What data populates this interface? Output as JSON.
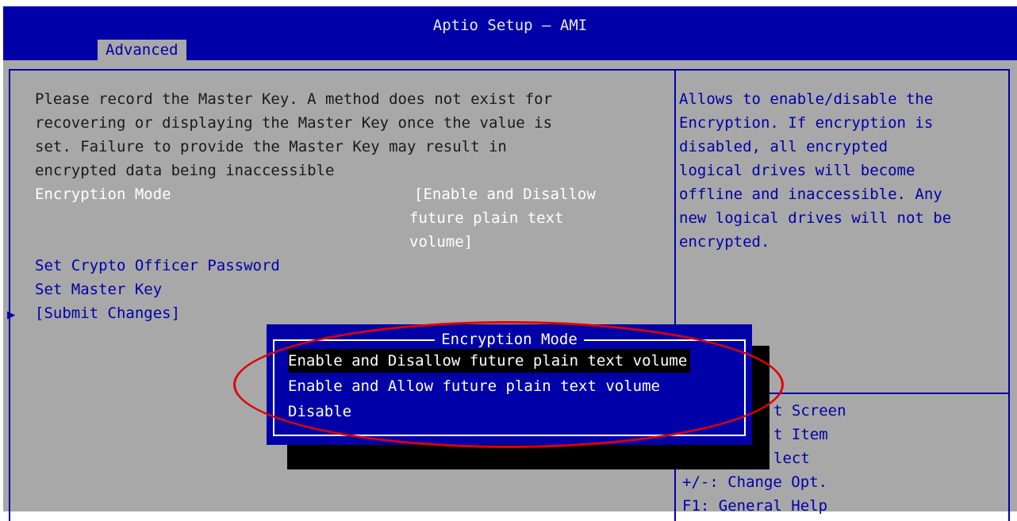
{
  "header": {
    "title": "Aptio Setup – AMI",
    "active_tab": "Advanced"
  },
  "main": {
    "message_lines": [
      "Please record the Master Key. A method does not exist for",
      "recovering or displaying the Master Key once the value is",
      "set. Failure to provide the Master Key may result in",
      "encrypted data being inaccessible"
    ],
    "encryption_mode_label": "Encryption Mode",
    "encryption_mode_value_lines": [
      "[Enable and Disallow",
      "future plain text",
      "volume]"
    ],
    "items": [
      "Set Crypto Officer Password",
      "Set Master Key",
      "[Submit Changes]"
    ]
  },
  "help": {
    "lines": [
      "Allows to enable/disable the",
      "Encryption. If encryption is",
      "disabled, all encrypted",
      "logical drives will become",
      "offline and inaccessible. Any",
      "new logical drives will not be",
      "encrypted."
    ]
  },
  "keys": {
    "lines": [
      "t Screen",
      "t Item",
      "lect",
      "+/-: Change Opt.",
      "F1: General Help"
    ]
  },
  "popup": {
    "title": "Encryption Mode",
    "options": [
      "Enable and Disallow future plain text volume",
      "Enable and Allow future plain text volume",
      "Disable"
    ],
    "selected_index": 0
  },
  "colors": {
    "bios_blue": "#0000a8",
    "bios_gray": "#a8a8a8",
    "annotation_red": "#e00000"
  }
}
